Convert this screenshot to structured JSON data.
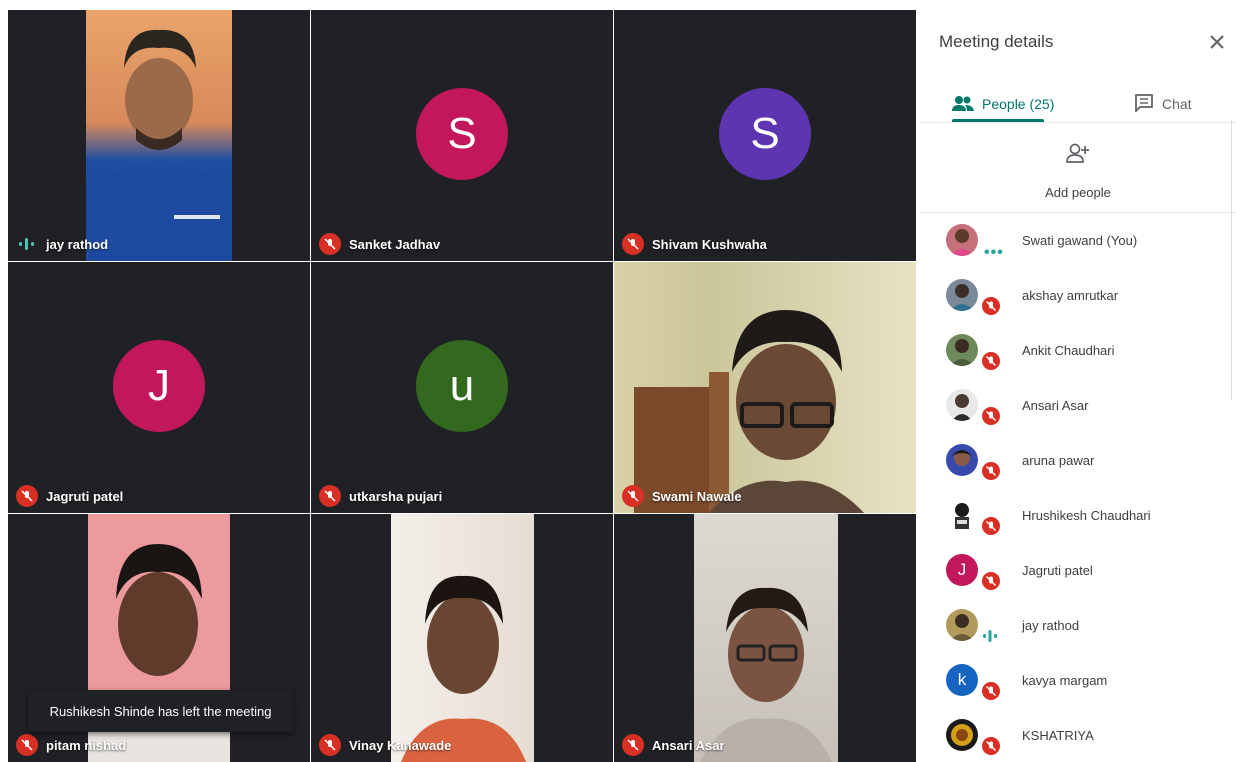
{
  "tiles": [
    {
      "name": "jay rathod",
      "status": "speaking"
    },
    {
      "name": "Sanket Jadhav",
      "initial": "S",
      "avatar_color": "#c2185b",
      "status": "muted"
    },
    {
      "name": "Shivam Kushwaha",
      "initial": "S",
      "avatar_color": "#5e35b1",
      "status": "muted"
    },
    {
      "name": "Jagruti patel",
      "initial": "J",
      "avatar_color": "#c2185b",
      "status": "muted"
    },
    {
      "name": "utkarsha pujari",
      "initial": "u",
      "avatar_color": "#33691e",
      "status": "muted"
    },
    {
      "name": "Swami Nawale",
      "status": "muted"
    },
    {
      "name": "pitam nishad",
      "status": "muted"
    },
    {
      "name": "Vinay Kanawade",
      "status": "muted"
    },
    {
      "name": "Ansari Asar",
      "status": "muted"
    }
  ],
  "toast": "Rushikesh Shinde has left the meeting",
  "panel": {
    "title": "Meeting details",
    "tab_people": "People (25)",
    "tab_chat": "Chat",
    "add_people": "Add people",
    "people": [
      {
        "name": "Swati gawand (You)",
        "status": "more"
      },
      {
        "name": "akshay amrutkar",
        "status": "muted"
      },
      {
        "name": "Ankit Chaudhari",
        "status": "muted"
      },
      {
        "name": "Ansari Asar",
        "status": "muted"
      },
      {
        "name": "aruna pawar",
        "status": "muted"
      },
      {
        "name": "Hrushikesh Chaudhari",
        "status": "muted"
      },
      {
        "name": "Jagruti patel",
        "initial": "J",
        "avatar_color": "#c2185b",
        "status": "muted"
      },
      {
        "name": "jay rathod",
        "status": "speaking"
      },
      {
        "name": "kavya margam",
        "initial": "k",
        "avatar_color": "#1565c0",
        "status": "muted"
      },
      {
        "name": "KSHATRIYA",
        "status": "muted"
      }
    ]
  },
  "colors": {
    "accent": "#00796b",
    "mute": "#d93025",
    "tile_bg": "#202124"
  }
}
